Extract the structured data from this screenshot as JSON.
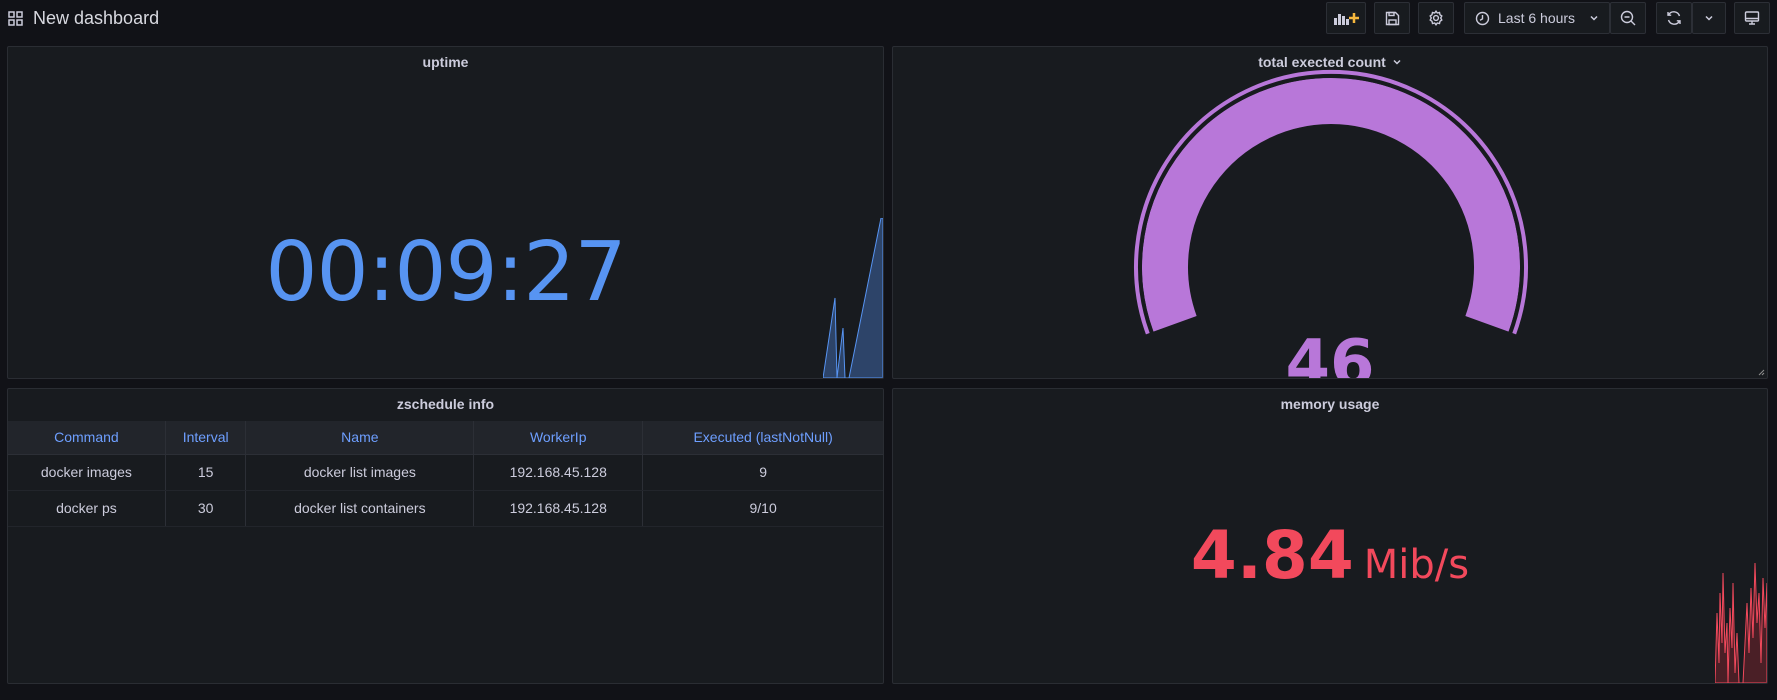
{
  "header": {
    "title": "New dashboard",
    "time_range": "Last 6 hours"
  },
  "panels": {
    "uptime": {
      "title": "uptime",
      "value": "00:09:27"
    },
    "executed": {
      "title": "total exected count",
      "value": "46",
      "gauge_fraction": 1.0
    },
    "table": {
      "title": "zschedule info",
      "columns": [
        "Command",
        "Interval",
        "Name",
        "WorkerIp",
        "Executed (lastNotNull)"
      ],
      "rows": [
        [
          "docker images",
          "15",
          "docker list images",
          "192.168.45.128",
          "9"
        ],
        [
          "docker ps",
          "30",
          "docker list containers",
          "192.168.45.128",
          "9/10"
        ]
      ]
    },
    "memory": {
      "title": "memory usage",
      "value": "4.84",
      "unit": "Mib/s"
    }
  },
  "colors": {
    "background": "#111217",
    "panel": "#181b1f",
    "uptime_blue": "#5794f2",
    "gauge_purple": "#b877d9",
    "memory_red": "#f2495c",
    "table_header_text": "#6e9fff"
  },
  "icons": {
    "dashboard": "grid-icon",
    "add_panel": "add-panel-icon",
    "save": "save-icon",
    "settings": "gear-icon",
    "clock": "clock-icon",
    "zoom_out": "zoom-out-icon",
    "refresh": "refresh-icon",
    "chevron": "chevron-down-icon",
    "tv_mode": "monitor-icon"
  }
}
